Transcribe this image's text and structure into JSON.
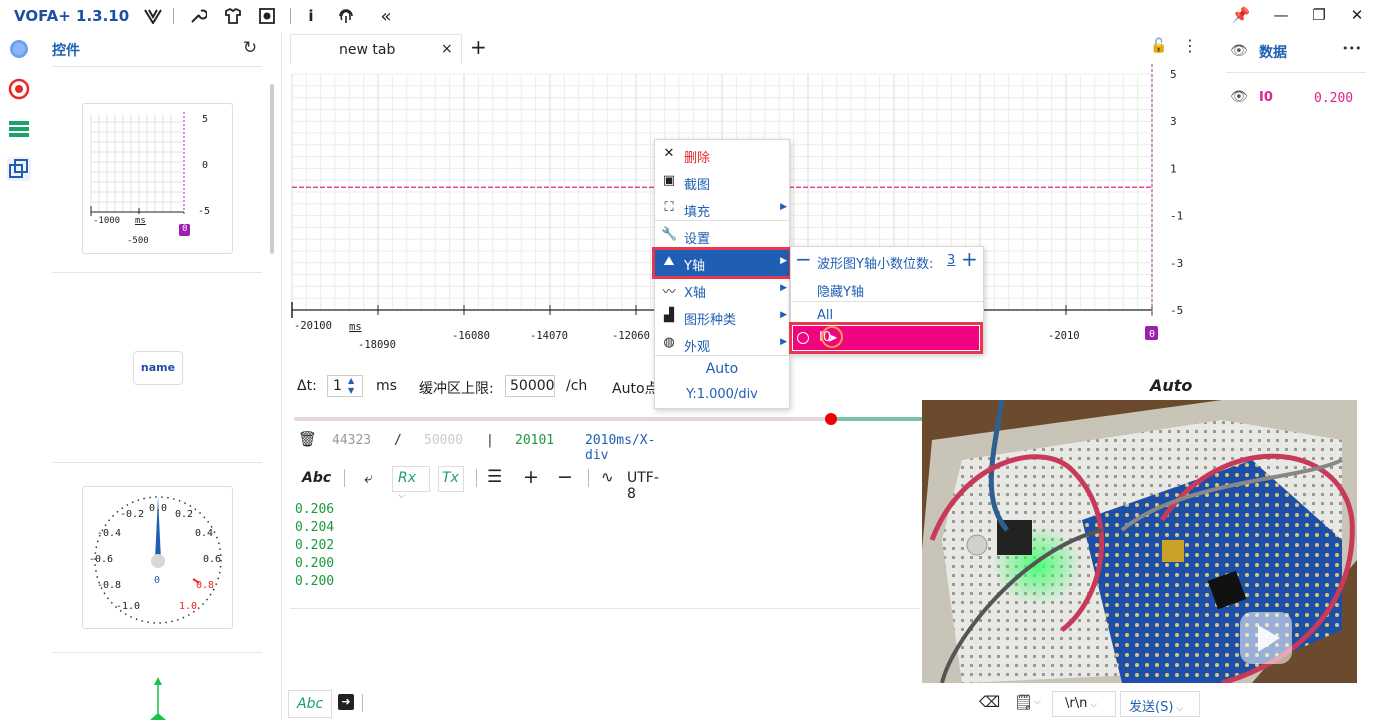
{
  "titlebar": {
    "app_title": "VOFA+ 1.3.10",
    "icons": [
      "vofa-logo-icon",
      "wrench-icon",
      "shirt-icon",
      "camera-icon",
      "info-icon",
      "fingerprint-icon",
      "double-chevron-left-icon"
    ],
    "window_buttons": [
      "pin-icon",
      "minimize-icon",
      "restore-icon",
      "close-icon"
    ]
  },
  "leftbar": {
    "icons": [
      "circle-icon",
      "record-icon",
      "list-icon",
      "layers-icon"
    ]
  },
  "widgets": {
    "title": "控件",
    "mini_plot": {
      "y_ticks": [
        "5",
        "0",
        "-5"
      ],
      "x_ticks": [
        "-1000",
        "-500"
      ],
      "x_unit": "ms",
      "badge": "0"
    },
    "button_label": "name",
    "gauge": {
      "ticks": [
        "-0.2",
        "0.0",
        "0.2",
        "-0.4",
        "0.4",
        "-0.6",
        "0.6",
        "-0.8",
        "0.8",
        "-1.0",
        "1.0"
      ],
      "value": "0"
    }
  },
  "tabs": {
    "label": "new tab",
    "close": "×",
    "add": "+"
  },
  "chart_data": {
    "type": "line",
    "series": [
      {
        "name": "I0",
        "x": [
          -20100,
          0
        ],
        "values": [
          0.2,
          0.2
        ],
        "color": "#e0228a"
      }
    ],
    "x_ticks": [
      "-20100",
      "-18090",
      "-16080",
      "-14070",
      "-12060",
      "-2010"
    ],
    "x_unit": "ms",
    "y_ticks": [
      "5",
      "3",
      "1",
      "-1",
      "-3",
      "-5"
    ],
    "ylim": [
      -5,
      5
    ],
    "cursor_badge": "0",
    "grid": true
  },
  "controls": {
    "dt_label": "Δt:",
    "dt_value": "1",
    "dt_unit": "ms",
    "buffer_label": "缓冲区上限:",
    "buffer_value": "50000",
    "buffer_unit": "/ch",
    "auto_points": "Auto点",
    "auto_right": "Auto",
    "slider_fraction": 0.85
  },
  "status": {
    "count": "44323",
    "slash": "/",
    "max": "50000",
    "bar": "|",
    "points": "20101",
    "div": "2010ms/X-div"
  },
  "rx_toolbar": {
    "abc": "Abc",
    "rx": "Rx",
    "tx": "Tx",
    "plus": "+",
    "minus": "−",
    "encoding": "UTF-8"
  },
  "rx_log": [
    "0.206",
    "0.204",
    "0.202",
    "0.200",
    "0.200"
  ],
  "bottombar": {
    "abc": "Abc",
    "line_ending": "\\r\\n",
    "send": "发送(S)"
  },
  "data_panel": {
    "title": "数据",
    "more": "•••",
    "items": [
      {
        "name": "I0",
        "value": "0.200"
      }
    ]
  },
  "context_menu": {
    "items": [
      {
        "label": "删除",
        "icon": "x-icon",
        "red": true,
        "arrow": false
      },
      {
        "label": "截图",
        "icon": "screenshot-icon",
        "arrow": false
      },
      {
        "label": "填充",
        "icon": "fill-icon",
        "arrow": true
      },
      {
        "label": "设置",
        "icon": "wrench-icon",
        "arrow": false
      },
      {
        "label": "Y轴",
        "icon": "y-axis-icon",
        "arrow": true,
        "active": true
      },
      {
        "label": "X轴",
        "icon": "x-axis-icon",
        "arrow": true
      },
      {
        "label": "图形种类",
        "icon": "chart-type-icon",
        "arrow": true
      },
      {
        "label": "外观",
        "icon": "appearance-icon",
        "arrow": true
      }
    ],
    "auto": "Auto",
    "ydiv": "Y:1.000/div"
  },
  "y_submenu": {
    "decimals_label": "波形图Y轴小数位数:",
    "decimals_value": "3",
    "hide_label": "隐藏Y轴",
    "all_label": "All",
    "channel_label": "I0"
  },
  "colors": {
    "accent": "#1f5fb3",
    "series": "#e0228a",
    "rx_text": "#1a9a3a",
    "highlight_red": "#e8384d",
    "submenu_select": "#f0047f"
  }
}
